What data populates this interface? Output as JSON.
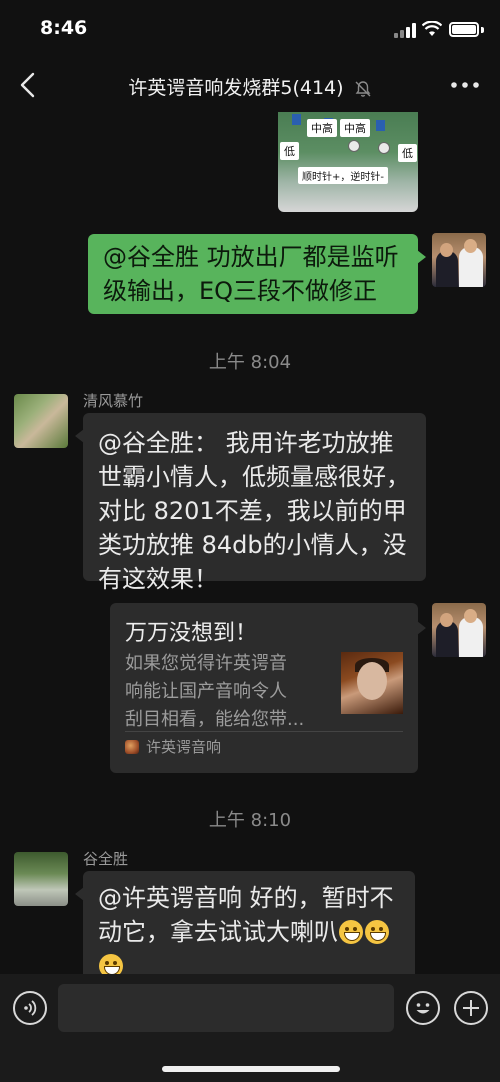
{
  "status_bar": {
    "time": "8:46"
  },
  "nav": {
    "title": "许英谔音响发烧群5(414)",
    "muted": true
  },
  "image_message": {
    "labels": {
      "mid_high_1": "中高",
      "mid_high_2": "中高",
      "low_left": "低",
      "low_right": "低",
      "caption": "顺时针+，逆时针-"
    }
  },
  "messages": {
    "self_msg_1": {
      "lines": [
        "@谷全胜 功放出厂都是监听",
        "级输出，EQ三段不做修正"
      ]
    },
    "time_1": "上午 8:04",
    "qfmz": {
      "name": "清风慕竹",
      "lines": [
        "@谷全胜： 我用许老功放推",
        "世霸小情人，低频量感很好，",
        "对比 8201不差，我以前的甲",
        "类功放推 84db的小情人，没",
        "有这效果！"
      ]
    },
    "card": {
      "title": "万万没想到！",
      "desc_lines": [
        "如果您觉得许英谔音",
        "响能让国产音响令人",
        "刮目相看，能给您带..."
      ],
      "source": "许英谔音响"
    },
    "time_2": "上午 8:10",
    "gqs": {
      "name": "谷全胜",
      "line_1": "@许英谔音响 好的，暂时不",
      "line_2": "动它，拿去试试大喇叭"
    }
  },
  "input_bar": {
    "placeholder": ""
  },
  "colors": {
    "accent_green": "#58b45c",
    "background": "#111111",
    "bubble_gray": "#2c2c2c"
  }
}
